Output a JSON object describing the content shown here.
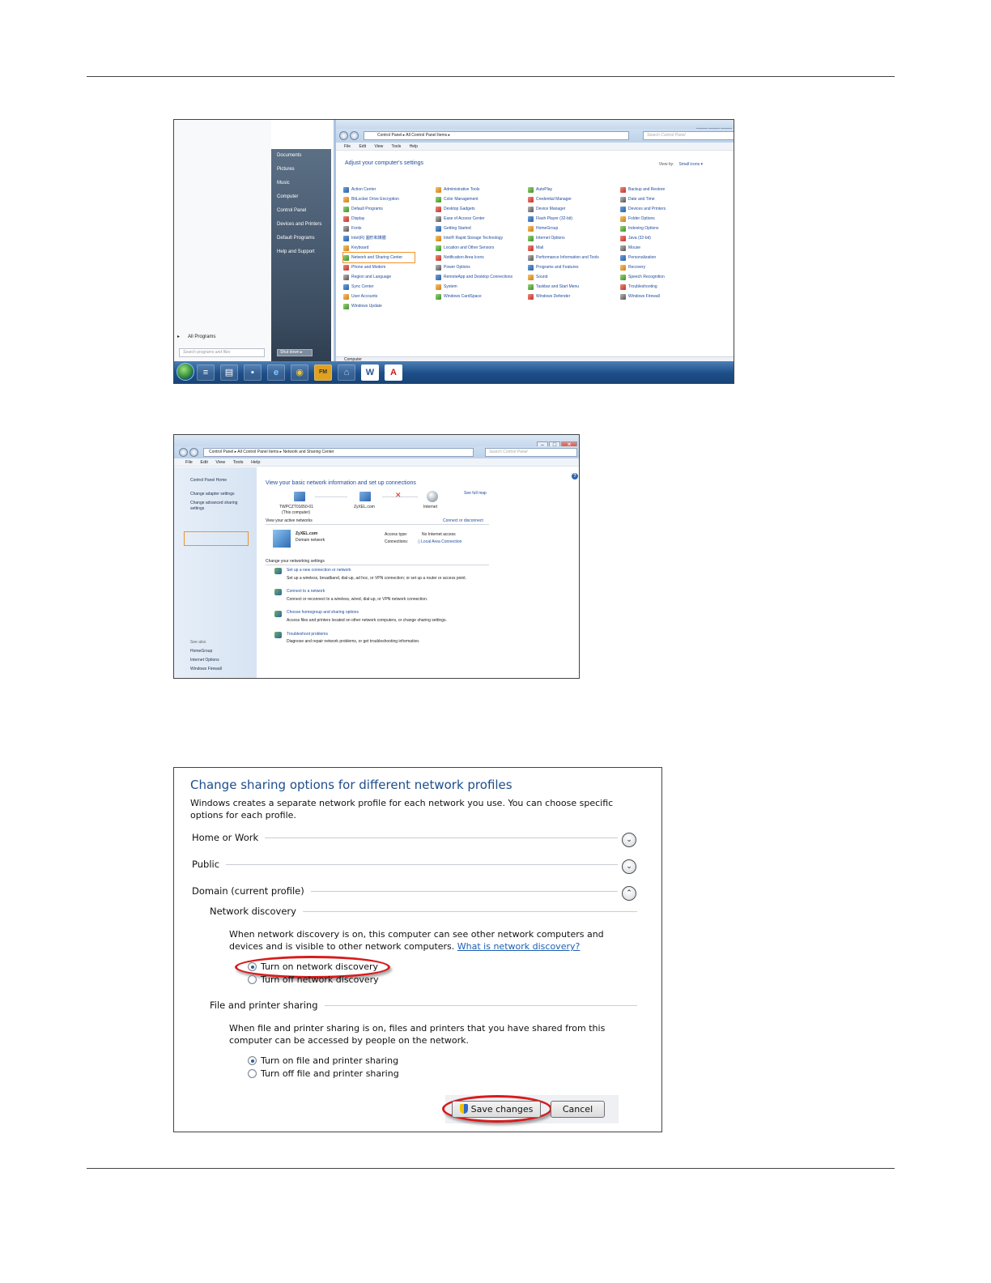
{
  "shot1": {
    "start_menu": {
      "items": [
        "Documents",
        "Pictures",
        "Music",
        "Computer",
        "Control Panel",
        "Devices and Printers",
        "Default Programs",
        "Help and Support"
      ],
      "all_programs": "All Programs",
      "search_placeholder": "Search programs and files",
      "shutdown_label": "Shut down"
    },
    "control_panel": {
      "breadcrumb": "Control Panel  ▸  All Control Panel Items  ▸",
      "search_placeholder": "Search Control Panel",
      "menu": [
        "File",
        "Edit",
        "View",
        "Tools",
        "Help"
      ],
      "heading": "Adjust your computer's settings",
      "view_by_label": "View by:",
      "view_by_value": "Small icons ▾",
      "status_label": "Computer",
      "items": [
        [
          "Action Center",
          "Administrative Tools",
          "AutoPlay",
          "Backup and Restore"
        ],
        [
          "BitLocker Drive Encryption",
          "Color Management",
          "Credential Manager",
          "Date and Time"
        ],
        [
          "Default Programs",
          "Desktop Gadgets",
          "Device Manager",
          "Devices and Printers"
        ],
        [
          "Display",
          "Ease of Access Center",
          "Flash Player (32-bit)",
          "Folder Options"
        ],
        [
          "Fonts",
          "Getting Started",
          "HomeGroup",
          "Indexing Options"
        ],
        [
          "Intel(R) 圖形和媒體",
          "Intel® Rapid Storage Technology",
          "Internet Options",
          "Java (32-bit)"
        ],
        [
          "Keyboard",
          "Location and Other Sensors",
          "Mail",
          "Mouse"
        ],
        [
          "Network and Sharing Center",
          "Notification Area Icons",
          "Performance Information and Tools",
          "Personalization"
        ],
        [
          "Phone and Modem",
          "Power Options",
          "Programs and Features",
          "Recovery"
        ],
        [
          "Region and Language",
          "RemoteApp and Desktop Connections",
          "Sound",
          "Speech Recognition"
        ],
        [
          "Sync Center",
          "System",
          "Taskbar and Start Menu",
          "Troubleshooting"
        ],
        [
          "User Accounts",
          "Windows CardSpace",
          "Windows Defender",
          "Windows Firewall"
        ],
        [
          "Windows Update",
          "",
          "",
          ""
        ]
      ],
      "highlighted_item": "Network and Sharing Center"
    },
    "taskbar_icons": [
      "explorer-icon",
      "file-manager-icon",
      "notepad-icon",
      "terminal-icon",
      "ie-icon",
      "chrome-icon",
      "fm-icon",
      "network-icon",
      "word-icon",
      "pdf-icon"
    ],
    "taskbar_labels": {
      "fm": "FM",
      "word": "W",
      "pdf": "A"
    }
  },
  "shot2": {
    "breadcrumb": "Control Panel  ▸  All Control Panel Items  ▸  Network and Sharing Center",
    "search_placeholder": "Search Control Panel",
    "menu": [
      "File",
      "Edit",
      "View",
      "Tools",
      "Help"
    ],
    "sidebar": {
      "home": "Control Panel Home",
      "change_adapter": "Change adapter settings",
      "change_advanced_1": "Change advanced sharing",
      "change_advanced_2": "settings",
      "see_also": "See also",
      "links": [
        "HomeGroup",
        "Internet Options",
        "Windows Firewall"
      ]
    },
    "main": {
      "heading": "View your basic network information and set up connections",
      "see_full_map": "See full map",
      "computer_name": "TWPCZT01650-01",
      "computer_sub": "(This computer)",
      "network_name": "ZyXEL.com",
      "internet": "Internet",
      "active_networks": "View your active networks",
      "connect_disconnect": "Connect or disconnect",
      "active_name": "ZyXEL.com",
      "active_type": "Domain network",
      "access_type_label": "Access type:",
      "access_type_value": "No Internet access",
      "connections_label": "Connections:",
      "connections_value": "Local Area Connection",
      "change_settings": "Change your networking settings",
      "tasks": [
        {
          "title": "Set up a new connection or network",
          "desc": "Set up a wireless, broadband, dial-up, ad hoc, or VPN connection; or set up a router or access point."
        },
        {
          "title": "Connect to a network",
          "desc": "Connect or reconnect to a wireless, wired, dial-up, or VPN network connection."
        },
        {
          "title": "Choose homegroup and sharing options",
          "desc": "Access files and printers located on other network computers, or change sharing settings."
        },
        {
          "title": "Troubleshoot problems",
          "desc": "Diagnose and repair network problems, or get troubleshooting information."
        }
      ]
    }
  },
  "shot3": {
    "title": "Change sharing options for different network profiles",
    "description": "Windows creates a separate network profile for each network you use. You can choose specific options for each profile.",
    "profiles": {
      "home": "Home or Work",
      "public": "Public",
      "domain": "Domain (current profile)"
    },
    "network_discovery": {
      "heading": "Network discovery",
      "text": "When network discovery is on, this computer can see other network computers and devices and is visible to other network computers.",
      "link": "What is network discovery?",
      "on": "Turn on network discovery",
      "off": "Turn off network discovery"
    },
    "file_sharing": {
      "heading": "File and printer sharing",
      "text": "When file and printer sharing is on, files and printers that you have shared from this computer can be accessed by people on the network.",
      "on": "Turn on file and printer sharing",
      "off": "Turn off file and printer sharing"
    },
    "save": "Save changes",
    "cancel": "Cancel",
    "colors": {
      "accent": "#1e4d8c",
      "highlight_red": "#d81b1b",
      "highlight_orange": "#f0922a"
    }
  }
}
